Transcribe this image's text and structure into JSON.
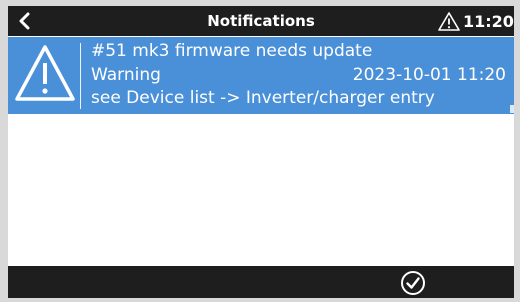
{
  "header": {
    "title": "Notifications",
    "back_icon": "chevron-left-icon",
    "alarm_icon": "warning-triangle-icon",
    "clock": "11:20"
  },
  "notification": {
    "icon": "warning-triangle-icon",
    "title": "#51 mk3 firmware needs update",
    "type": "Warning",
    "timestamp": "2023-10-01 11:20",
    "description": "see Device list -> Inverter/charger entry",
    "background_color": "#4a90d9"
  },
  "footer": {
    "confirm_icon": "check-circle-icon"
  },
  "colors": {
    "bar": "#1e1e1e",
    "highlight": "#4a90d9",
    "background": "#ffffff"
  }
}
